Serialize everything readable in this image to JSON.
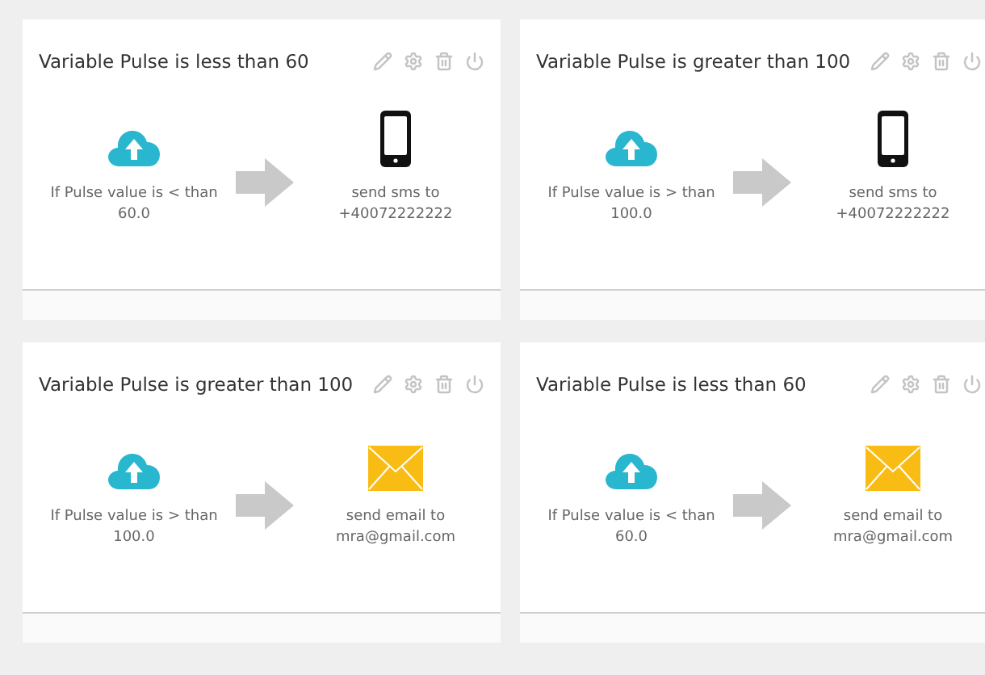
{
  "rules": [
    {
      "title": "Variable Pulse is less than 60",
      "condition": "If Pulse value is < than 60.0",
      "action": {
        "kind": "sms",
        "text": "send sms to +40072222222"
      }
    },
    {
      "title": "Variable Pulse is greater than 100",
      "condition": "If Pulse value is > than 100.0",
      "action": {
        "kind": "sms",
        "text": "send sms to +40072222222"
      }
    },
    {
      "title": "Variable Pulse is greater than 100",
      "condition": "If Pulse value is > than 100.0",
      "action": {
        "kind": "email",
        "text": "send email to mra@gmail.com"
      }
    },
    {
      "title": "Variable Pulse is less than 60",
      "condition": "If Pulse value is < than 60.0",
      "action": {
        "kind": "email",
        "text": "send email to mra@gmail.com"
      }
    }
  ]
}
